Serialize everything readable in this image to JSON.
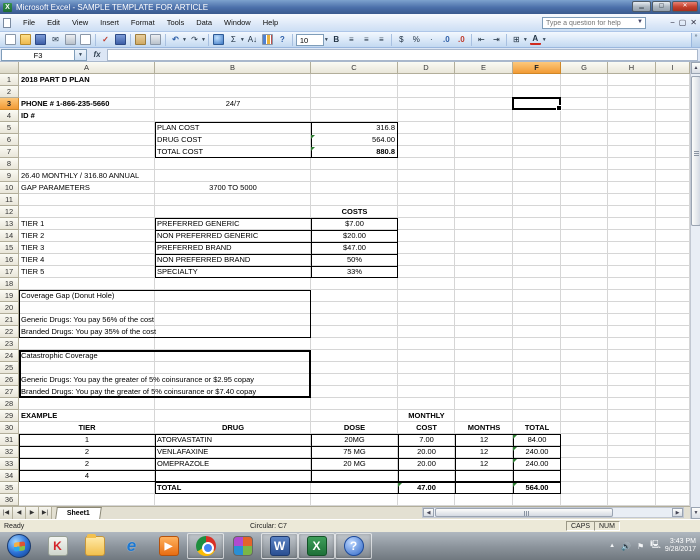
{
  "window": {
    "title": "Microsoft Excel - SAMPLE TEMPLATE FOR ARTICLE"
  },
  "menu": {
    "items": [
      "File",
      "Edit",
      "View",
      "Insert",
      "Format",
      "Tools",
      "Data",
      "Window",
      "Help"
    ],
    "question_placeholder": "Type a question for help"
  },
  "toolbar": {
    "font_size": "10",
    "standard_icons": [
      "new",
      "open",
      "save",
      "email",
      "print",
      "print-preview",
      "spelling",
      "research",
      "paste",
      "format-painter",
      "undo",
      "redo",
      "hyperlink",
      "autosum",
      "sort-ascending",
      "chart-wizard",
      "help"
    ],
    "formatting_icons": [
      "bold",
      "align-left",
      "align-center",
      "align-right",
      "currency",
      "percent",
      "comma",
      "increase-decimal",
      "decrease-decimal",
      "decrease-indent",
      "increase-indent",
      "borders",
      "font-color"
    ]
  },
  "formula_bar": {
    "name_box": "F3"
  },
  "grid": {
    "columns": [
      "A",
      "B",
      "C",
      "D",
      "E",
      "F",
      "G",
      "H",
      "I"
    ],
    "selected_column": "F",
    "selected_row": 3,
    "selection": "F3",
    "rows_visible": 36,
    "cells": [
      {
        "r": 1,
        "c": "A",
        "t": "2018 PART D PLAN",
        "b": 1
      },
      {
        "r": 3,
        "c": "A",
        "t": "PHONE # 1-866-235-5660",
        "b": 1
      },
      {
        "r": 3,
        "c": "B",
        "t": "24/7",
        "a": "c"
      },
      {
        "r": 4,
        "c": "A",
        "t": "ID #",
        "b": 1
      },
      {
        "r": 5,
        "c": "B",
        "t": "PLAN COST"
      },
      {
        "r": 5,
        "c": "C",
        "t": "316.8",
        "a": "r"
      },
      {
        "r": 6,
        "c": "B",
        "t": "DRUG COST"
      },
      {
        "r": 6,
        "c": "C",
        "t": "564.00",
        "a": "r",
        "e": 1
      },
      {
        "r": 7,
        "c": "B",
        "t": "TOTAL COST"
      },
      {
        "r": 7,
        "c": "C",
        "t": "880.8",
        "a": "r",
        "b": 1,
        "e": 1
      },
      {
        "r": 9,
        "c": "A",
        "t": "26.40 MONTHLY / 316.80 ANNUAL"
      },
      {
        "r": 10,
        "c": "A",
        "t": "GAP PARAMETERS"
      },
      {
        "r": 10,
        "c": "B",
        "t": "3700 TO 5000",
        "a": "c"
      },
      {
        "r": 12,
        "c": "C",
        "t": "COSTS",
        "a": "c",
        "b": 1
      },
      {
        "r": 13,
        "c": "A",
        "t": "TIER 1"
      },
      {
        "r": 13,
        "c": "B",
        "t": "PREFERRED GENERIC"
      },
      {
        "r": 13,
        "c": "C",
        "t": "$7.00",
        "a": "c"
      },
      {
        "r": 14,
        "c": "A",
        "t": "TIER 2"
      },
      {
        "r": 14,
        "c": "B",
        "t": "NON PREFERRED GENERIC"
      },
      {
        "r": 14,
        "c": "C",
        "t": "$20.00",
        "a": "c"
      },
      {
        "r": 15,
        "c": "A",
        "t": "TIER 3"
      },
      {
        "r": 15,
        "c": "B",
        "t": "PREFERRED BRAND"
      },
      {
        "r": 15,
        "c": "C",
        "t": "$47.00",
        "a": "c"
      },
      {
        "r": 16,
        "c": "A",
        "t": "TIER 4"
      },
      {
        "r": 16,
        "c": "B",
        "t": "NON PREFERRED BRAND"
      },
      {
        "r": 16,
        "c": "C",
        "t": "50%",
        "a": "c"
      },
      {
        "r": 17,
        "c": "A",
        "t": "TIER 5"
      },
      {
        "r": 17,
        "c": "B",
        "t": "SPECIALTY"
      },
      {
        "r": 17,
        "c": "C",
        "t": "33%",
        "a": "c"
      },
      {
        "r": 19,
        "c": "A",
        "t": "Coverage Gap (Donut Hole)"
      },
      {
        "r": 21,
        "c": "A",
        "t": "Generic Drugs: You pay 56% of the cost"
      },
      {
        "r": 22,
        "c": "A",
        "t": "Branded Drugs: You pay 35% of the cost"
      },
      {
        "r": 24,
        "c": "A",
        "t": "Catastrophic Coverage"
      },
      {
        "r": 26,
        "c": "A",
        "t": "Generic Drugs: You pay the greater of 5% coinsurance or $2.95 copay"
      },
      {
        "r": 27,
        "c": "A",
        "t": "Branded Drugs: You pay the greater of 5% coinsurance or $7.40 copay"
      },
      {
        "r": 29,
        "c": "A",
        "t": "EXAMPLE",
        "b": 1
      },
      {
        "r": 29,
        "c": "D",
        "t": "MONTHLY",
        "a": "c",
        "b": 1
      },
      {
        "r": 30,
        "c": "A",
        "t": "TIER",
        "a": "c",
        "b": 1
      },
      {
        "r": 30,
        "c": "B",
        "t": "DRUG",
        "a": "c",
        "b": 1
      },
      {
        "r": 30,
        "c": "C",
        "t": "DOSE",
        "a": "c",
        "b": 1
      },
      {
        "r": 30,
        "c": "D",
        "t": "COST",
        "a": "c",
        "b": 1
      },
      {
        "r": 30,
        "c": "E",
        "t": "MONTHS",
        "a": "c",
        "b": 1
      },
      {
        "r": 30,
        "c": "F",
        "t": "TOTAL",
        "a": "c",
        "b": 1
      },
      {
        "r": 31,
        "c": "A",
        "t": "1",
        "a": "c"
      },
      {
        "r": 31,
        "c": "B",
        "t": "ATORVASTATIN"
      },
      {
        "r": 31,
        "c": "C",
        "t": "20MG",
        "a": "c"
      },
      {
        "r": 31,
        "c": "D",
        "t": "7.00",
        "a": "c"
      },
      {
        "r": 31,
        "c": "E",
        "t": "12",
        "a": "c"
      },
      {
        "r": 31,
        "c": "F",
        "t": "84.00",
        "a": "c",
        "e": 1
      },
      {
        "r": 32,
        "c": "A",
        "t": "2",
        "a": "c"
      },
      {
        "r": 32,
        "c": "B",
        "t": "VENLAFAXINE"
      },
      {
        "r": 32,
        "c": "C",
        "t": "75 MG",
        "a": "c"
      },
      {
        "r": 32,
        "c": "D",
        "t": "20.00",
        "a": "c"
      },
      {
        "r": 32,
        "c": "E",
        "t": "12",
        "a": "c"
      },
      {
        "r": 32,
        "c": "F",
        "t": "240.00",
        "a": "c",
        "e": 1
      },
      {
        "r": 33,
        "c": "A",
        "t": "2",
        "a": "c"
      },
      {
        "r": 33,
        "c": "B",
        "t": "OMEPRAZOLE"
      },
      {
        "r": 33,
        "c": "C",
        "t": "20 MG",
        "a": "c"
      },
      {
        "r": 33,
        "c": "D",
        "t": "20.00",
        "a": "c"
      },
      {
        "r": 33,
        "c": "E",
        "t": "12",
        "a": "c"
      },
      {
        "r": 33,
        "c": "F",
        "t": "240.00",
        "a": "c",
        "e": 1
      },
      {
        "r": 34,
        "c": "A",
        "t": "4",
        "a": "c"
      },
      {
        "r": 35,
        "c": "B",
        "t": "TOTAL",
        "b": 1
      },
      {
        "r": 35,
        "c": "D",
        "t": "47.00",
        "a": "c",
        "b": 1,
        "e": 1
      },
      {
        "r": 35,
        "c": "F",
        "t": "564.00",
        "a": "c",
        "b": 1,
        "e": 1
      }
    ]
  },
  "sheet_tabs": {
    "active": "Sheet1"
  },
  "status_bar": {
    "left": "Ready",
    "center": "Circular: C7",
    "indicators": [
      "CAPS",
      "NUM"
    ]
  },
  "taskbar": {
    "icons": [
      "start",
      "kaspersky",
      "windows-explorer",
      "internet-explorer",
      "media-player",
      "chrome",
      "media-center",
      "word",
      "excel",
      "help"
    ],
    "clock_time": "3:43 PM",
    "clock_date": "9/28/2017"
  },
  "colors": {
    "selected_header": "#f7a94f",
    "title_bar": "#4a6ea9",
    "error_indicator": "#2e7d32"
  }
}
